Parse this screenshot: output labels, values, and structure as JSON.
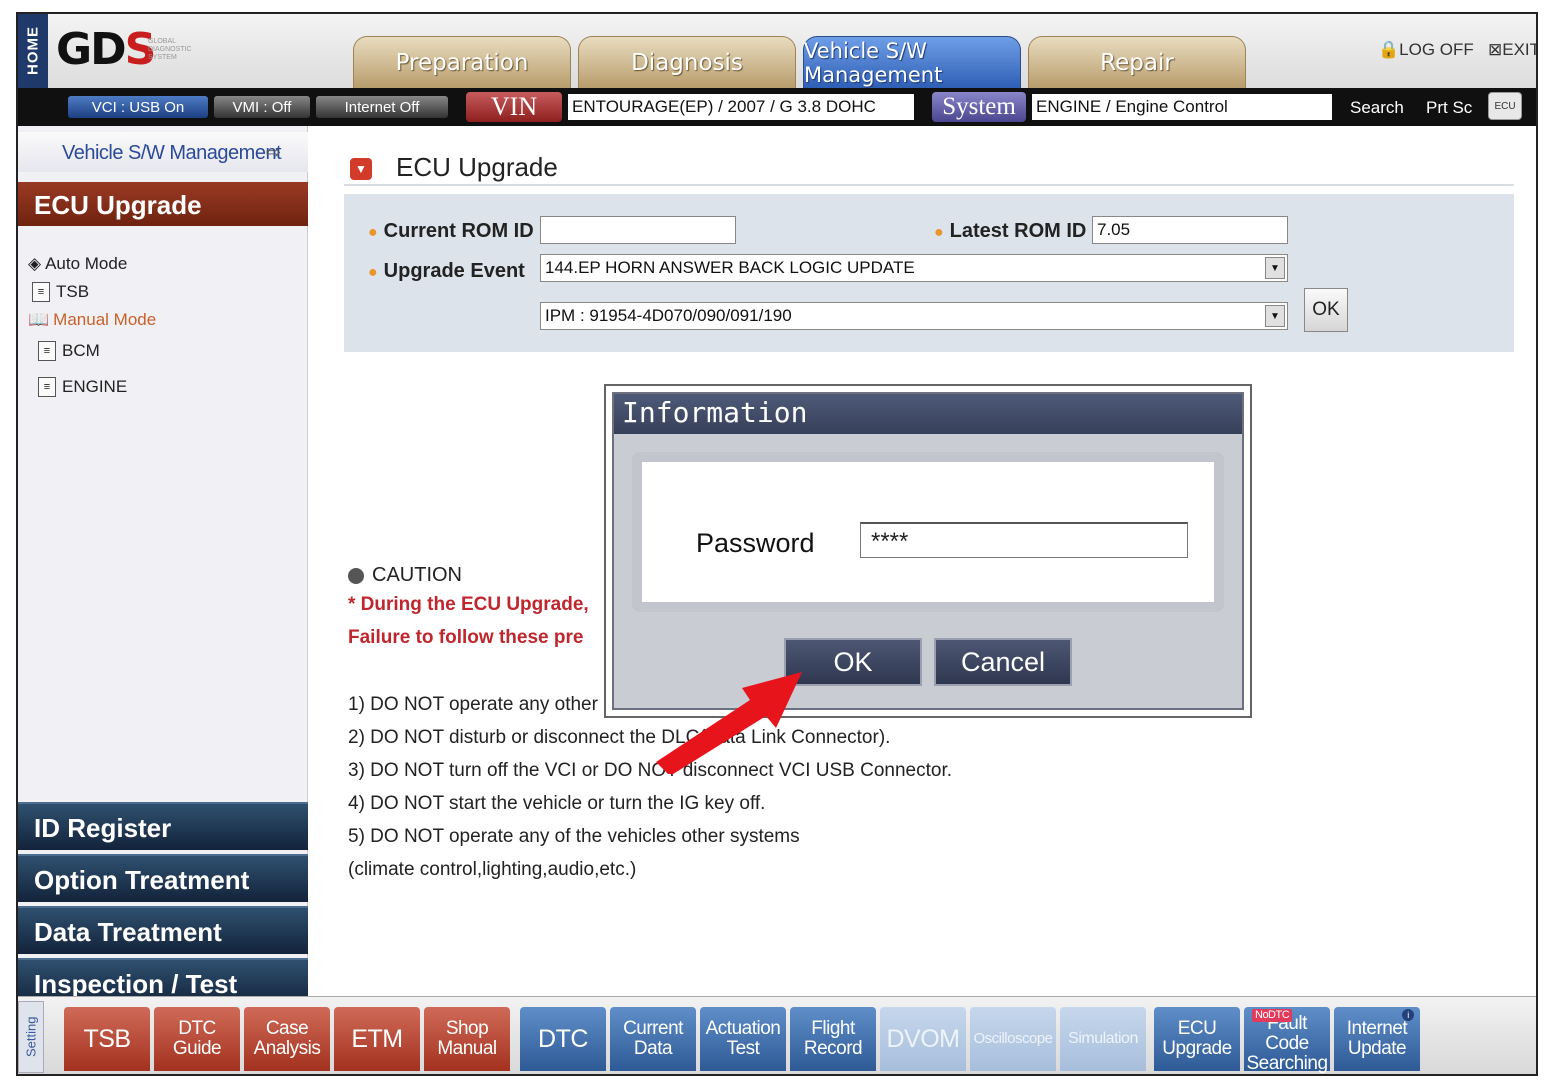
{
  "header": {
    "home_label": "HOME",
    "logo_text": "GDS",
    "logo_subtext": "GLOBAL DIAGNOSTIC SYSTEM",
    "tabs": [
      {
        "label": "Preparation",
        "active": false
      },
      {
        "label": "Diagnosis",
        "active": false
      },
      {
        "label": "Vehicle S/W Management",
        "active": true
      },
      {
        "label": "Repair",
        "active": false
      }
    ],
    "log_off": "LOG OFF",
    "exit": "EXIT"
  },
  "status": {
    "vci": "VCI : USB On",
    "vmi": "VMI : Off",
    "internet": "Internet Off",
    "vin_label": "VIN",
    "vin_value": "ENTOURAGE(EP) / 2007 / G 3.8 DOHC",
    "system_label": "System",
    "system_value": "ENGINE / Engine Control",
    "search": "Search",
    "prtsc": "Prt Sc",
    "ecu_icon": "ECU"
  },
  "sidebar": {
    "title": "Vehicle S/W Management",
    "section": "ECU Upgrade",
    "items": [
      {
        "label": "Auto Mode",
        "icon": "diamond-icon"
      },
      {
        "label": "TSB",
        "icon": "document-icon"
      },
      {
        "label": "Manual Mode",
        "icon": "book-icon"
      },
      {
        "label": "BCM",
        "icon": "document-icon"
      },
      {
        "label": "ENGINE",
        "icon": "document-icon"
      }
    ],
    "bottom": [
      "ID Register",
      "Option Treatment",
      "Data Treatment",
      "Inspection / Test"
    ]
  },
  "main": {
    "title": "ECU Upgrade",
    "current_rom_label": "Current ROM ID",
    "current_rom_value": "",
    "latest_rom_label": "Latest ROM ID",
    "latest_rom_value": "7.05",
    "upgrade_event_label": "Upgrade Event",
    "upgrade_event_value": "144.EP HORN ANSWER BACK LOGIC UPDATE",
    "ipm_value": "IPM : 91954-4D070/090/091/190",
    "ok_label": "OK",
    "caution_title": "CAUTION",
    "caution_line1": "* During the ECU Upgrade,",
    "caution_line2": "Failure to follow these pre",
    "rules": [
      "1) DO NOT operate any other",
      "2) DO NOT disturb or disconnect the DLC(Data Link Connector).",
      "3) DO NOT turn off the VCI or DO NOT disconnect VCI USB Connector.",
      "4) DO NOT start the vehicle or turn the IG key off.",
      "5) DO NOT operate any of the vehicles other systems",
      "(climate control,lighting,audio,etc.)"
    ]
  },
  "dialog": {
    "title": "Information",
    "password_label": "Password",
    "password_value": "****",
    "ok": "OK",
    "cancel": "Cancel"
  },
  "toolbar": {
    "setting": "Setting",
    "buttons": [
      {
        "label": "TSB",
        "style": "red"
      },
      {
        "label": "DTC Guide",
        "style": "red"
      },
      {
        "label": "Case Analysis",
        "style": "red"
      },
      {
        "label": "ETM",
        "style": "red"
      },
      {
        "label": "Shop Manual",
        "style": "red"
      },
      {
        "label": "DTC",
        "style": "blue"
      },
      {
        "label": "Current Data",
        "style": "blue"
      },
      {
        "label": "Actuation Test",
        "style": "blue"
      },
      {
        "label": "Flight Record",
        "style": "blue"
      },
      {
        "label": "DVOM",
        "style": "faded"
      },
      {
        "label": "Oscilloscope",
        "style": "faded"
      },
      {
        "label": "Simulation",
        "style": "faded"
      },
      {
        "label": "ECU Upgrade",
        "style": "blue"
      },
      {
        "label": "Fault Code Searching",
        "style": "blue",
        "badge": "NoDTC"
      },
      {
        "label": "Internet Update",
        "style": "blue",
        "info": "i"
      }
    ]
  },
  "colors": {
    "accent_red": "#c0262d",
    "header_tab_active": "#2f5fb5",
    "sidebar_section": "#6f2310",
    "dialog_title": "#37405a"
  }
}
